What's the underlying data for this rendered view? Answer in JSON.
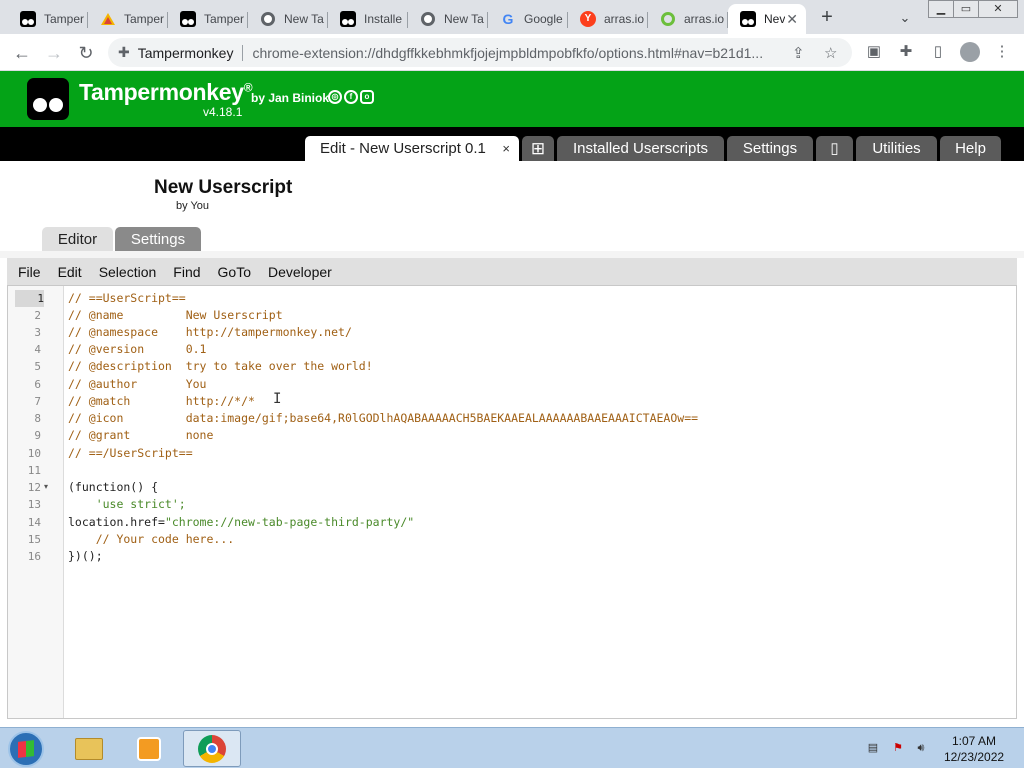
{
  "browser": {
    "tabs": [
      {
        "label": "Tamper",
        "icon": "tampermonkey-icon"
      },
      {
        "label": "Tamper",
        "icon": "tampermonkey-rainbow-icon"
      },
      {
        "label": "Tamper",
        "icon": "tampermonkey-icon"
      },
      {
        "label": "New Ta",
        "icon": "chrome-icon"
      },
      {
        "label": "Installe",
        "icon": "tampermonkey-icon"
      },
      {
        "label": "New Ta",
        "icon": "chrome-icon"
      },
      {
        "label": "Google",
        "icon": "google-icon"
      },
      {
        "label": "arras.io",
        "icon": "yandex-icon"
      },
      {
        "label": "arras.io",
        "icon": "arras-icon"
      },
      {
        "label": "Nev",
        "icon": "tampermonkey-icon",
        "active": true
      }
    ],
    "new_tab_label": "+",
    "tab_search_label": "⌄",
    "window_controls": {
      "minimize": "▁",
      "maximize": "▭",
      "close": "✕"
    },
    "omnibox": {
      "origin": "Tampermonkey",
      "url": "chrome-extension://dhdgffkkebhmkfjojejmpbldmpobfkfo/options.html#nav=b21d1..."
    }
  },
  "tampermonkey": {
    "brand": "Tampermonkey",
    "registered": "®",
    "byline": "by Jan Biniok",
    "version": "v4.18.1",
    "tabs": {
      "edit": "Edit - New Userscript 0.1",
      "edit_close": "×",
      "add": "⊞",
      "installed": "Installed Userscripts",
      "settings": "Settings",
      "donate": "▯",
      "utilities": "Utilities",
      "help": "Help"
    },
    "script": {
      "name": "New Userscript",
      "author": "by You"
    },
    "subtabs": {
      "editor": "Editor",
      "settings": "Settings"
    },
    "editor_menu": [
      "File",
      "Edit",
      "Selection",
      "Find",
      "GoTo",
      "Developer"
    ],
    "code": {
      "line_numbers": [
        "1",
        "2",
        "3",
        "4",
        "5",
        "6",
        "7",
        "8",
        "9",
        "10",
        "11",
        "12",
        "13",
        "14",
        "15",
        "16"
      ],
      "active_line": 1,
      "fold_marker": "▾",
      "lines": [
        {
          "text": "// ==UserScript==",
          "kind": "cmt"
        },
        {
          "text": "// @name         New Userscript",
          "kind": "cmt"
        },
        {
          "text": "// @namespace    http://tampermonkey.net/",
          "kind": "cmt"
        },
        {
          "text": "// @version      0.1",
          "kind": "cmt"
        },
        {
          "text": "// @description  try to take over the world!",
          "kind": "cmt"
        },
        {
          "text": "// @author       You",
          "kind": "cmt"
        },
        {
          "text": "// @match        http://*/*",
          "kind": "cmt"
        },
        {
          "text": "// @icon         data:image/gif;base64,R0lGODlhAQABAAAAACH5BAEKAAEALAAAAAABAAEAAAICTAEAOw==",
          "kind": "cmt"
        },
        {
          "text": "// @grant        none",
          "kind": "cmt"
        },
        {
          "text": "// ==/UserScript==",
          "kind": "cmt"
        },
        {
          "text": "",
          "kind": "kw"
        },
        {
          "text": "(function() {",
          "kind": "kw"
        },
        {
          "text": "    'use strict';",
          "kind": "str"
        },
        {
          "text": "location.href=\"chrome://new-tab-page-third-party/\"",
          "kind": "mixed"
        },
        {
          "text": "    // Your code here...",
          "kind": "cmt"
        },
        {
          "text": "})();",
          "kind": "kw"
        }
      ]
    }
  },
  "taskbar": {
    "apps": [
      {
        "name": "file-explorer-icon"
      },
      {
        "name": "media-player-icon"
      },
      {
        "name": "chrome-icon",
        "active": true
      }
    ],
    "time": "1:07 AM",
    "date": "12/23/2022"
  }
}
